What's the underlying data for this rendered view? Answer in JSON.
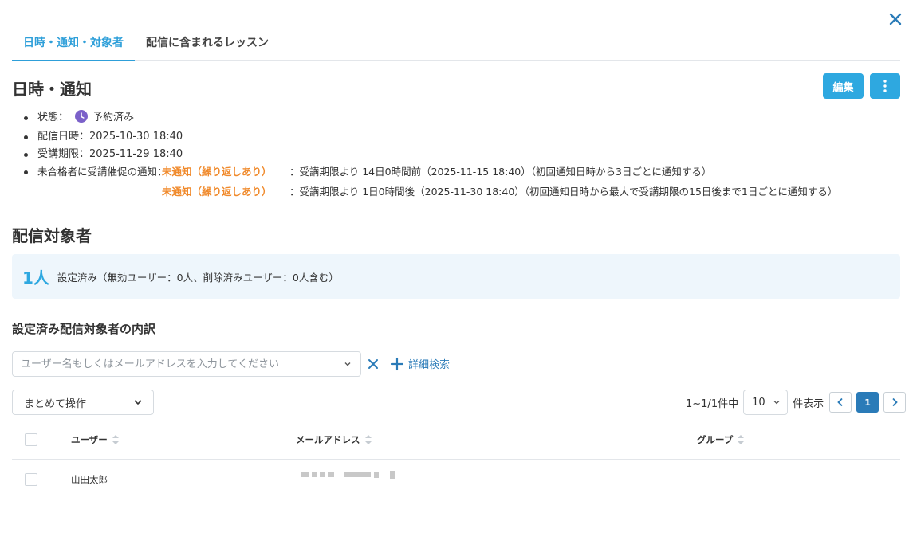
{
  "tabs": [
    {
      "label": "日時・通知・対象者",
      "active": true
    },
    {
      "label": "配信に含まれるレッスン",
      "active": false
    }
  ],
  "schedule": {
    "title": "日時・通知",
    "edit_label": "編集",
    "status_label": "状態：",
    "status_value": "予約済み",
    "delivery_label": "配信日時：",
    "delivery_value": "2025-10-30 18:40",
    "deadline_label": "受講期限：",
    "deadline_value": "2025-11-29 18:40",
    "reminder_label": "未合格者に受講催促の通知：",
    "reminders": [
      {
        "status": "未通知（繰り返しあり）",
        "text": "：受講期限より 14日0時間前（2025-11-15 18:40）（初回通知日時から3日ごとに通知する）"
      },
      {
        "status": "未通知（繰り返しあり）",
        "text": "：受講期限より 1日0時間後（2025-11-30 18:40）（初回通知日時から最大で受講期限の15日後まで1日ごとに通知する）"
      }
    ]
  },
  "targets": {
    "title": "配信対象者",
    "count": "1人",
    "summary": "設定済み（無効ユーザー：0人、削除済みユーザー：0人含む）",
    "breakdown_title": "設定済み配信対象者の内訳",
    "search_placeholder": "ユーザー名もしくはメールアドレスを入力してください",
    "advanced_search": "詳細検索",
    "bulk_action": "まとめて操作",
    "result_count": "1~1/1件中",
    "per_page": "10",
    "per_page_suffix": "件表示",
    "current_page": "1",
    "columns": {
      "user": "ユーザー",
      "email": "メールアドレス",
      "group": "グループ"
    },
    "rows": [
      {
        "user": "山田太郎",
        "email": "",
        "group": ""
      }
    ]
  },
  "colors": {
    "accent": "#2ea8e0",
    "warning": "#f08a2c",
    "status_purple": "#7b61c9",
    "link": "#2a7bb8"
  }
}
